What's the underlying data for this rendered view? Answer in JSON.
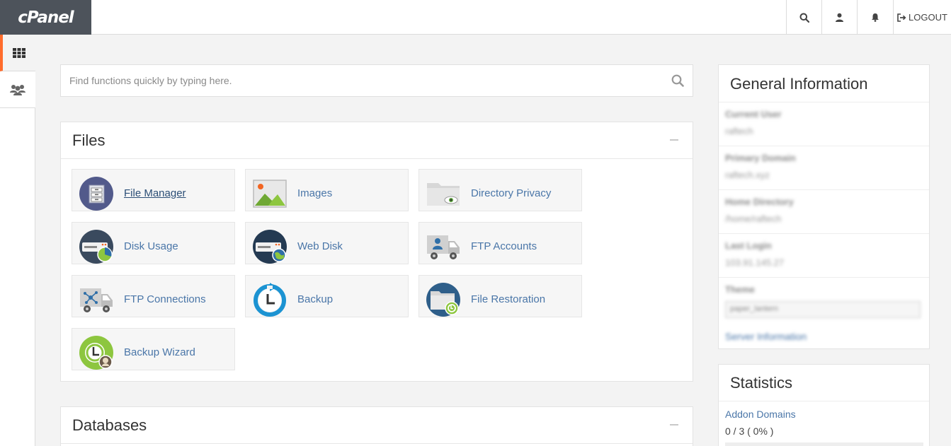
{
  "header": {
    "logo_text": "cPanel",
    "logout_label": "LOGOUT",
    "icons": [
      "search-icon",
      "user-icon",
      "bell-icon",
      "logout-icon"
    ]
  },
  "rail": {
    "items": [
      "grid-icon",
      "users-icon"
    ]
  },
  "search": {
    "placeholder": "Find functions quickly by typing here."
  },
  "files": {
    "title": "Files",
    "tiles": [
      {
        "label": "File Manager"
      },
      {
        "label": "Images"
      },
      {
        "label": "Directory Privacy"
      },
      {
        "label": "Disk Usage"
      },
      {
        "label": "Web Disk"
      },
      {
        "label": "FTP Accounts"
      },
      {
        "label": "FTP Connections"
      },
      {
        "label": "Backup"
      },
      {
        "label": "File Restoration"
      },
      {
        "label": "Backup Wizard"
      }
    ]
  },
  "databases": {
    "title": "Databases"
  },
  "general_info": {
    "title": "General Information",
    "rows": [
      {
        "key": "Current User",
        "value": "raftech"
      },
      {
        "key": "Primary Domain",
        "value": "raftech.xyz"
      },
      {
        "key": "Home Directory",
        "value": "/home/raftech"
      },
      {
        "key": "Last Login",
        "value": "103.91.145.27"
      }
    ],
    "theme_label": "Theme",
    "theme_value": "paper_lantern",
    "server_info_link": "Server Information"
  },
  "statistics": {
    "title": "Statistics",
    "items": [
      {
        "name": "Addon Domains",
        "value": "0 / 3 ( 0% )"
      }
    ]
  },
  "colors": {
    "accent": "#ff6c2c",
    "link": "#4a76a8",
    "logo_bg": "#4d535b"
  }
}
